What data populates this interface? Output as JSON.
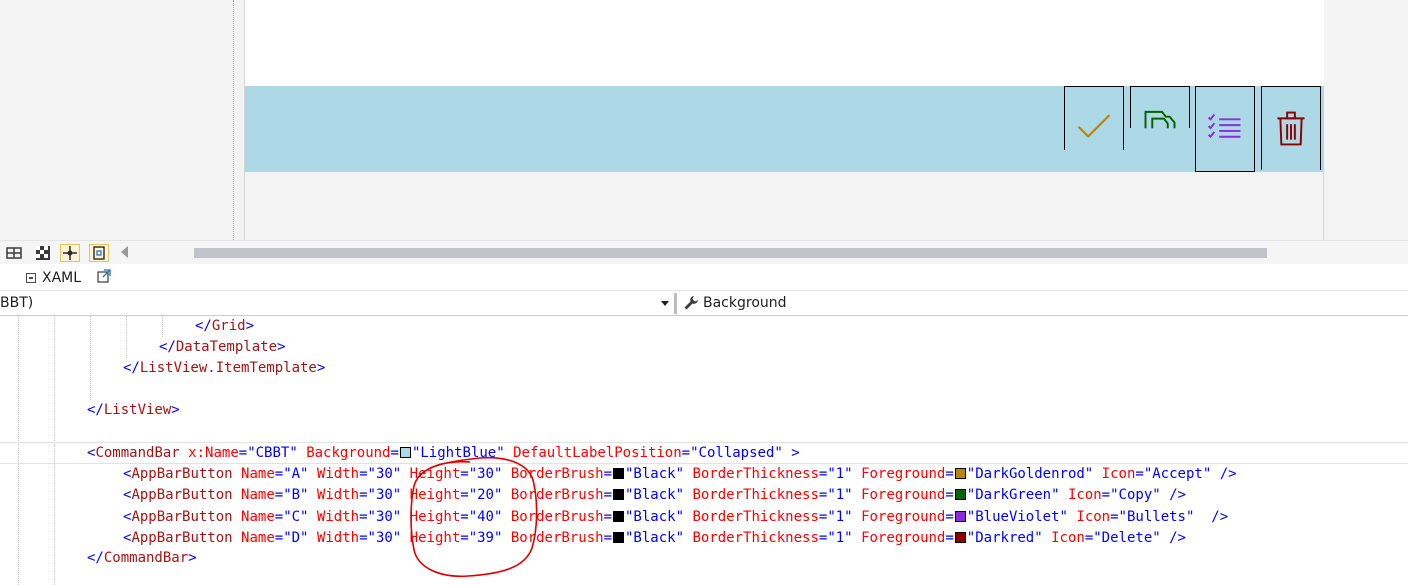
{
  "designer": {
    "commandbar_background": "#add8e6",
    "buttons": [
      {
        "name": "A",
        "icon": "check-icon",
        "color": "#b8860b"
      },
      {
        "name": "B",
        "icon": "copy-icon",
        "color": "#006400"
      },
      {
        "name": "C",
        "icon": "bullets-icon",
        "color": "#8a2be2"
      },
      {
        "name": "D",
        "icon": "delete-icon",
        "color": "#8b0000"
      }
    ]
  },
  "tabs": {
    "xaml_label": "XAML"
  },
  "nav": {
    "left_value": "BBT)",
    "right_value": "Background"
  },
  "code": {
    "l1_tag": "Grid",
    "l2_tag": "DataTemplate",
    "l3_tag": "ListView.ItemTemplate",
    "l4_tag": "ListView",
    "cb": {
      "tag": "CommandBar",
      "a1": "x:Name",
      "v1": "\"CBBT\"",
      "a2": "Background",
      "v2": "\"LightBlue\"",
      "a3": "DefaultLabelPosition",
      "v3": "\"Collapsed\""
    },
    "btn_tag": "AppBarButton",
    "attr_name": "Name",
    "attr_width": "Width",
    "attr_height": "Height",
    "attr_brush": "BorderBrush",
    "attr_thick": "BorderThickness",
    "attr_fg": "Foreground",
    "attr_icon": "Icon",
    "rows": [
      {
        "name": "\"A\"",
        "width": "\"30\"",
        "height": "\"30\"",
        "brush": "\"Black\"",
        "thick": "\"1\"",
        "fg": "\"DarkGoldenrod\"",
        "fg_color": "#b8860b",
        "icon": "\"Accept\"",
        "close": " />"
      },
      {
        "name": "\"B\"",
        "width": "\"30\"",
        "height": "\"20\"",
        "brush": "\"Black\"",
        "thick": "\"1\"",
        "fg": "\"DarkGreen\"",
        "fg_color": "#006400",
        "icon": "\"Copy\"",
        "close": " />"
      },
      {
        "name": "\"C\"",
        "width": "\"30\"",
        "height": "\"40\"",
        "brush": "\"Black\"",
        "thick": "\"1\"",
        "fg": "\"BlueViolet\"",
        "fg_color": "#8a2be2",
        "icon": "\"Bullets\"",
        "close": "  />"
      },
      {
        "name": "\"D\"",
        "width": "\"30\"",
        "height": "\"39\"",
        "brush": "\"Black\"",
        "thick": "\"1\"",
        "fg": "\"Darkred\"",
        "fg_color": "#8b0000",
        "icon": "\"Delete\"",
        "close": " />"
      }
    ],
    "close_tag": "CommandBar"
  },
  "colors": {
    "tag": "#a31515",
    "attr": "#ff0000",
    "value": "#0000ff",
    "annotation": "#e00000"
  }
}
